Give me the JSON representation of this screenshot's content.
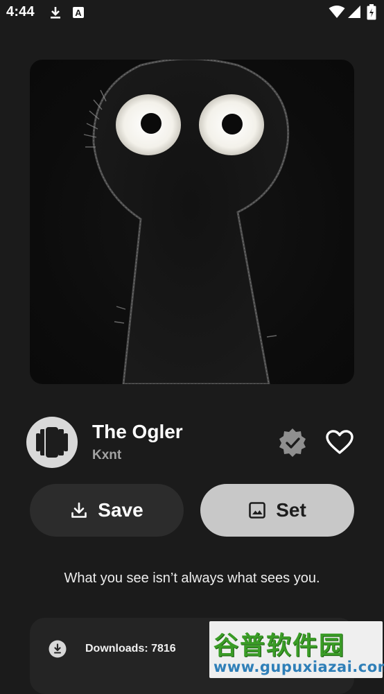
{
  "status_bar": {
    "time": "4:44",
    "icons": [
      "download-icon",
      "a-badge-icon",
      "wifi-icon",
      "signal-icon",
      "battery-icon"
    ]
  },
  "wallpaper": {
    "title": "The Ogler",
    "author": "Kxnt",
    "description": "What you see isn’t always what sees you.",
    "artwork_icon": "creature-artwork",
    "verified_icon": "verified-badge-icon",
    "favorite_icon": "heart-outline-icon"
  },
  "actions": {
    "save_label": "Save",
    "save_icon": "download-icon",
    "set_label": "Set",
    "set_icon": "image-icon"
  },
  "stats": {
    "downloads_label": "Downloads: 7816",
    "downloads_icon": "download-circle-icon"
  },
  "watermark": {
    "title": "谷普软件园",
    "url": "www.gupuxiazai.com"
  },
  "colors": {
    "background": "#1b1b1b",
    "save_button": "#2c2c2c",
    "set_button": "#c8c8c8",
    "author_text": "#a3a3a3",
    "verified_badge": "#8f8f8f"
  }
}
